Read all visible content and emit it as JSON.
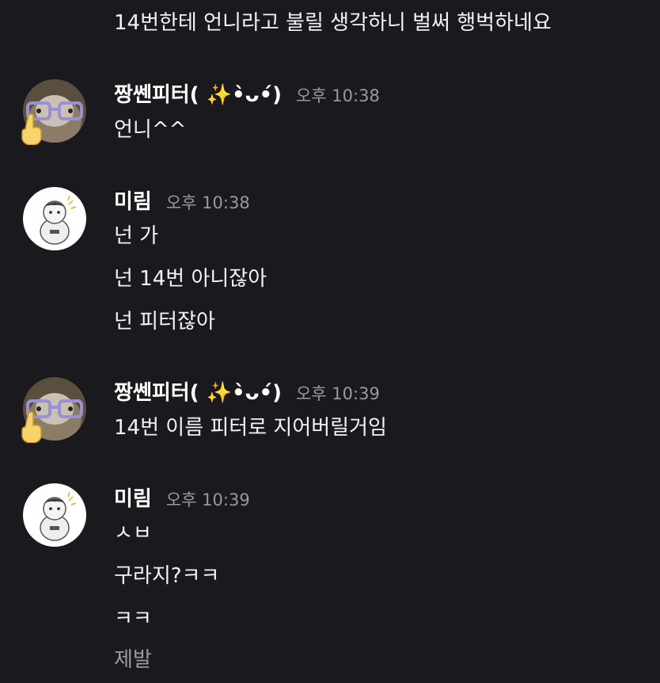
{
  "colors": {
    "background": "#1a1a1e",
    "text": "#f2f3f5",
    "username": "#ffffff",
    "timestamp": "#949ba4",
    "pending_text": "#9a9ba1"
  },
  "top_message": "14번한테 언니라고 불릴 생각하니 벌써 행벅하네요",
  "groups": [
    {
      "username": "짱쎈피터( ✨•̀ᴗ•́)",
      "avatar_icon": "glasses-cat-avatar",
      "timestamp": "오후 10:38",
      "messages": [
        "언니^^"
      ]
    },
    {
      "username": "미림",
      "avatar_icon": "hamster-avatar",
      "timestamp": "오후 10:38",
      "messages": [
        "넌 가",
        "넌 14번 아니잖아",
        "넌 피터잖아"
      ]
    },
    {
      "username": "짱쎈피터( ✨•̀ᴗ•́)",
      "avatar_icon": "glasses-cat-avatar",
      "timestamp": "오후 10:39",
      "messages": [
        "14번 이름 피터로 지어버릴거임"
      ]
    },
    {
      "username": "미림",
      "avatar_icon": "hamster-avatar",
      "timestamp": "오후 10:39",
      "messages": [
        "ㅅㅂ",
        "구라지?ㅋㅋ",
        "ㅋㅋ",
        "제발"
      ]
    }
  ]
}
